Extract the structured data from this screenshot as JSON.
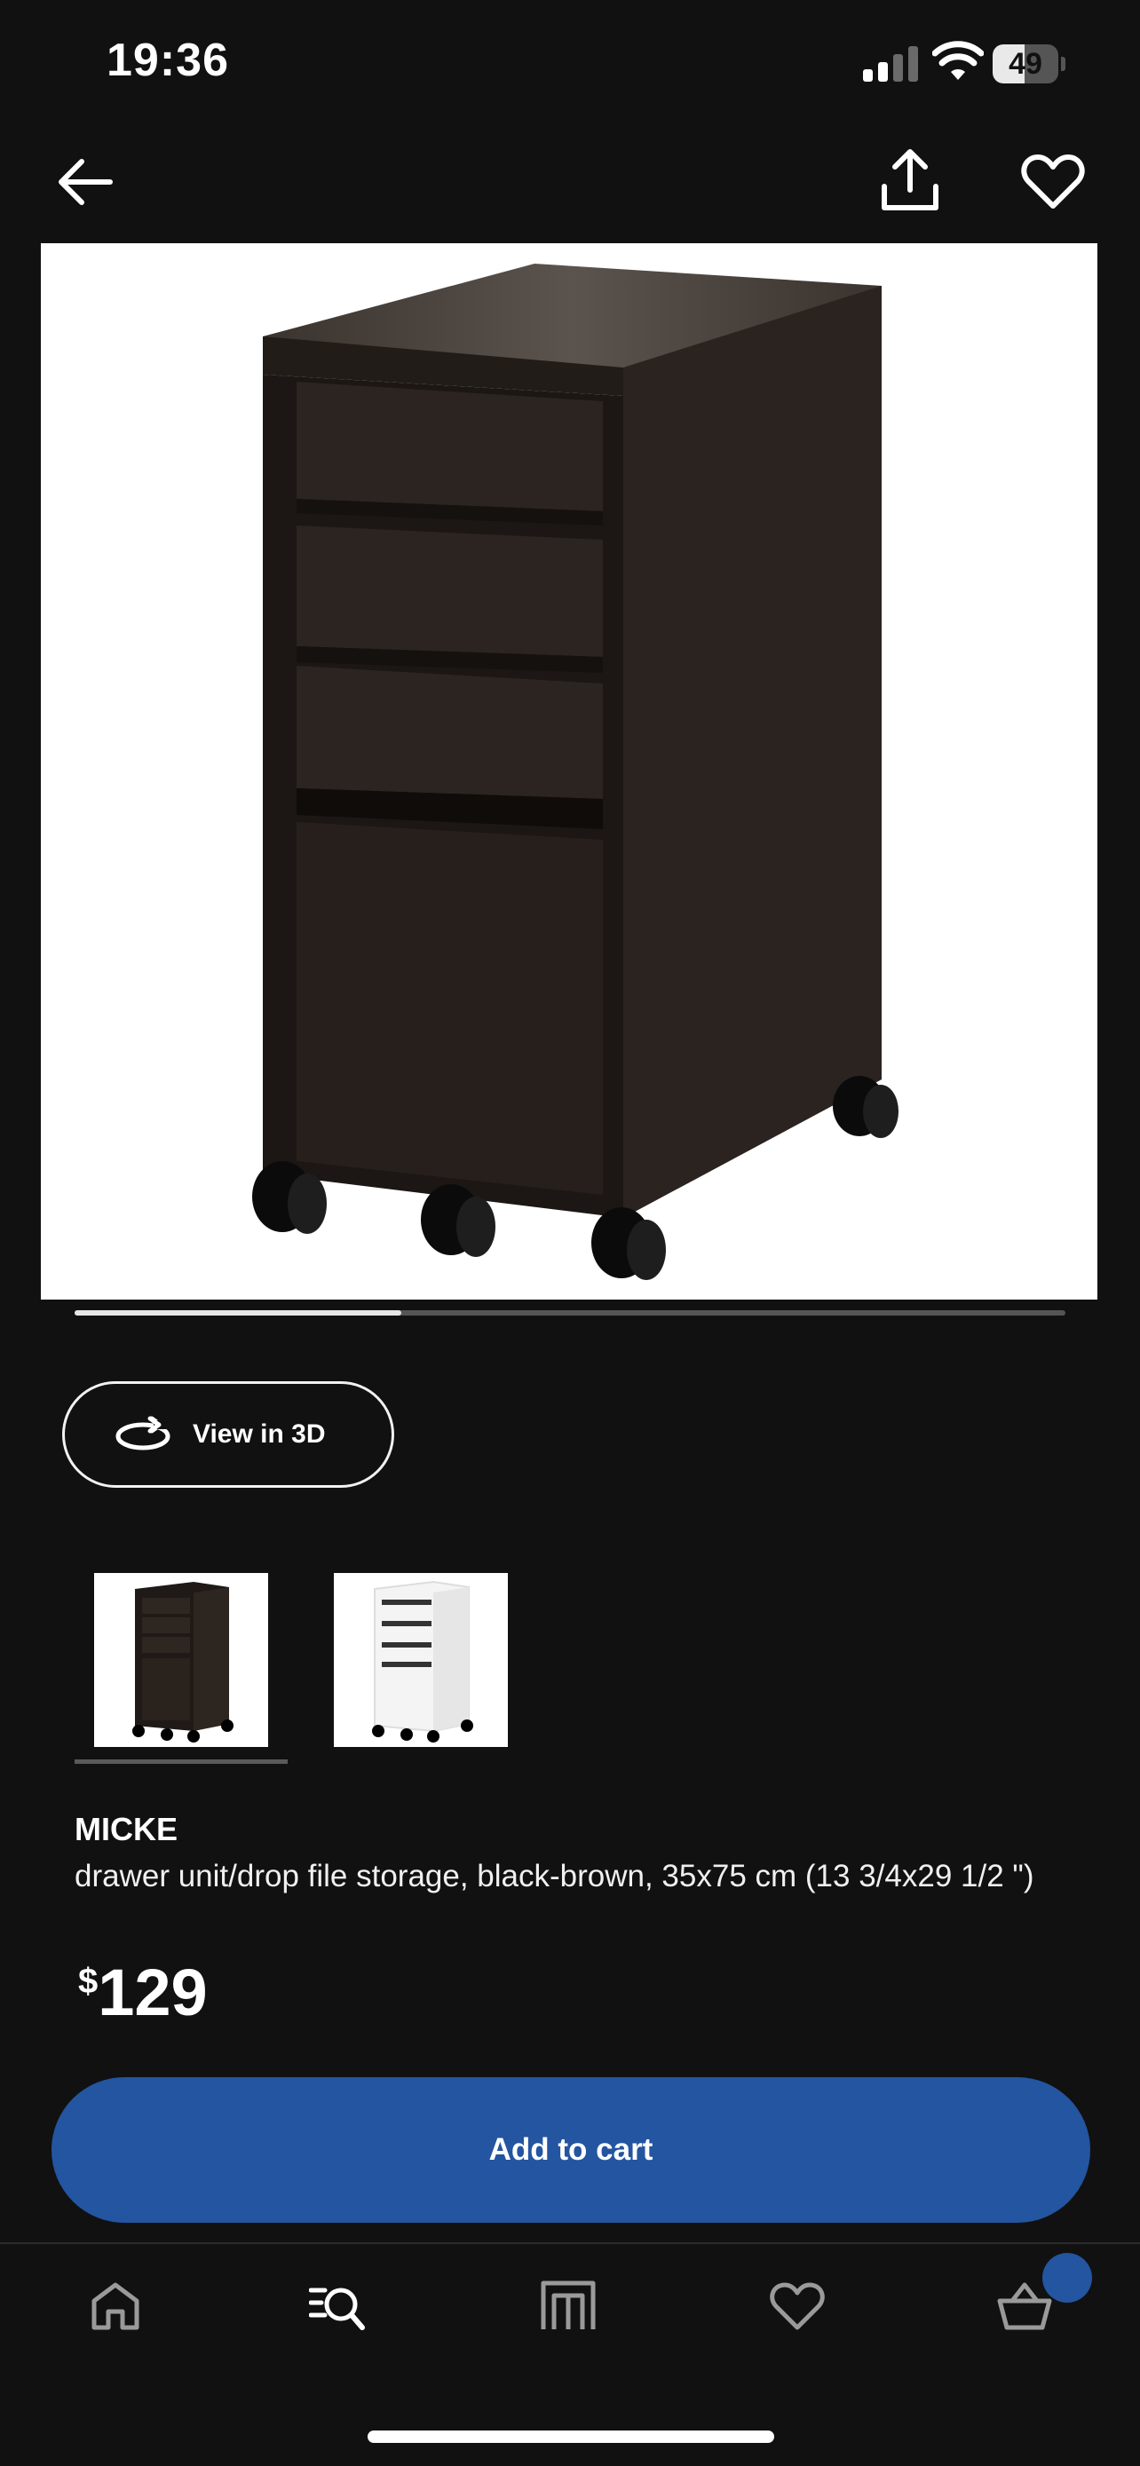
{
  "status_bar": {
    "time": "19:36",
    "battery_level": "49",
    "battery_fill_fraction": 0.49,
    "icons": [
      "signal-icon",
      "wifi-icon",
      "battery-icon"
    ]
  },
  "top_nav": {
    "icons": [
      "back-arrow-icon",
      "share-icon",
      "heart-icon"
    ]
  },
  "gallery": {
    "progress_fraction": 0.33,
    "view_3d_label": "View in 3D",
    "view_3d_icon": "rotate-3d-icon"
  },
  "variants": [
    {
      "color": "#2a221d",
      "selected": true
    },
    {
      "color": "#ffffff",
      "selected": false
    }
  ],
  "product": {
    "name": "MICKE",
    "description": "drawer unit/drop file storage, black-brown, 35x75 cm (13 3/4x29 1/2 \")",
    "price_currency": "$",
    "price_amount": "129"
  },
  "cta": {
    "add_to_cart": "Add to cart"
  },
  "bottom_nav": {
    "items": [
      "home-icon",
      "search-icon",
      "stores-icon",
      "favorites-icon",
      "cart-icon"
    ],
    "active": "search-icon",
    "cart_badge_color": "#2355a0"
  },
  "colors": {
    "background": "#111111",
    "accent": "#2355a0",
    "product_finish": "#2a221d"
  }
}
